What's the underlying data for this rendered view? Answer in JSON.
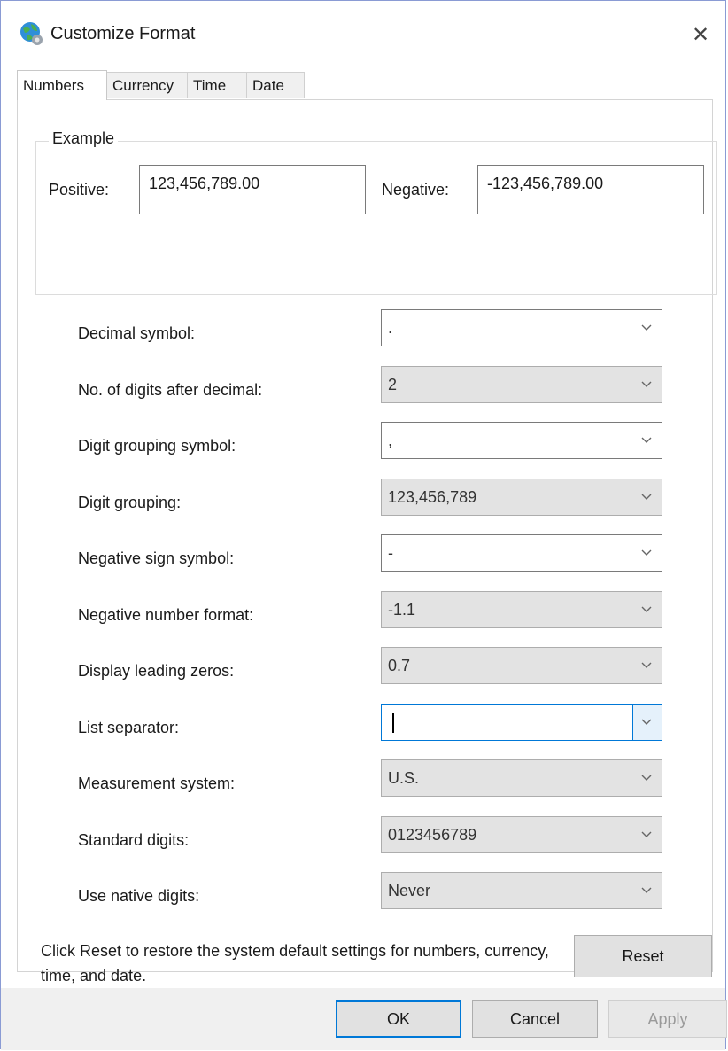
{
  "window": {
    "title": "Customize Format",
    "close_label": "✕"
  },
  "tabs": [
    {
      "label": "Numbers",
      "active": true
    },
    {
      "label": "Currency",
      "active": false
    },
    {
      "label": "Time",
      "active": false
    },
    {
      "label": "Date",
      "active": false
    }
  ],
  "example": {
    "legend": "Example",
    "positive_label": "Positive:",
    "positive_value": "123,456,789.00",
    "negative_label": "Negative:",
    "negative_value": "-123,456,789.00"
  },
  "settings": [
    {
      "label": "Decimal symbol:",
      "value": ".",
      "editable": true
    },
    {
      "label": "No. of digits after decimal:",
      "value": "2",
      "editable": false
    },
    {
      "label": "Digit grouping symbol:",
      "value": ",",
      "editable": true
    },
    {
      "label": "Digit grouping:",
      "value": "123,456,789",
      "editable": false
    },
    {
      "label": "Negative sign symbol:",
      "value": "-",
      "editable": true
    },
    {
      "label": "Negative number format:",
      "value": "-1.1",
      "editable": false
    },
    {
      "label": "Display leading zeros:",
      "value": "0.7",
      "editable": false
    },
    {
      "label": "List separator:",
      "value": "",
      "editable": true,
      "focused": true
    },
    {
      "label": "Measurement system:",
      "value": "U.S.",
      "editable": false
    },
    {
      "label": "Standard digits:",
      "value": "0123456789",
      "editable": false
    },
    {
      "label": "Use native digits:",
      "value": "Never",
      "editable": false
    }
  ],
  "reset": {
    "text": "Click Reset to restore the system default settings for numbers, currency, time, and date.",
    "button_label": "Reset"
  },
  "footer": {
    "ok_label": "OK",
    "cancel_label": "Cancel",
    "apply_label": "Apply"
  },
  "colors": {
    "accent": "#0078d7",
    "window_border": "#8a9bd4",
    "footer_bg": "#f0f0f0"
  }
}
